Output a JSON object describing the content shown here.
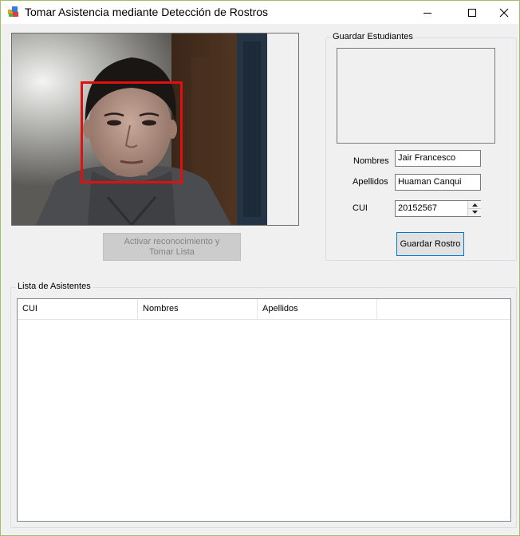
{
  "window": {
    "title": "Tomar Asistencia mediante Detección de Rostros",
    "minimize": "—",
    "maximize": "☐",
    "close": "✕"
  },
  "camera": {
    "detection_box_color": "#e01010"
  },
  "actions": {
    "activate_label": "Activar reconocimiento y Tomar Lista",
    "activate_enabled": false
  },
  "guardar": {
    "group_title": "Guardar Estudiantes",
    "nombres_label": "Nombres",
    "nombres_value": "Jair Francesco",
    "apellidos_label": "Apellidos",
    "apellidos_value": "Huaman Canqui",
    "cui_label": "CUI",
    "cui_value": "20152567",
    "save_label": "Guardar Rostro"
  },
  "lista": {
    "group_title": "Lista de Asistentes",
    "columns": [
      "CUI",
      "Nombres",
      "Apellidos"
    ],
    "rows": []
  },
  "colors": {
    "accent": "#0078d7",
    "window_border": "#a0c068"
  }
}
